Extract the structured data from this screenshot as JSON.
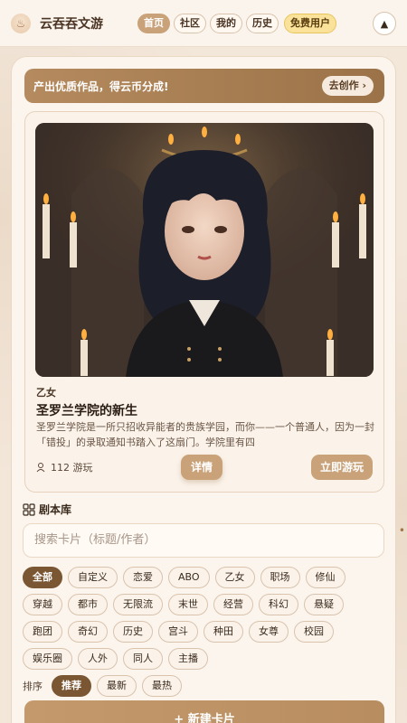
{
  "app": {
    "title": "云吞吞文游",
    "logo_icon": "♨"
  },
  "nav": {
    "tabs": [
      {
        "label": "首页",
        "active": true
      },
      {
        "label": "社区",
        "active": false
      },
      {
        "label": "我的",
        "active": false
      },
      {
        "label": "历史",
        "active": false
      }
    ],
    "badge": "免费用户",
    "up_icon": "▲"
  },
  "promo": {
    "text": "产出优质作品，得云币分成!",
    "button": "去创作 ›"
  },
  "featured": {
    "genre": "乙女",
    "title": "圣罗兰学院的新生",
    "desc": "圣罗兰学院是一所只招收异能者的贵族学园，而你——一个普通人，因为一封「错投」的录取通知书踏入了这扇门。学院里有四",
    "plays": "112 游玩",
    "detail_button": "详情",
    "play_button": "立即游玩"
  },
  "library": {
    "title": "剧本库",
    "search_placeholder": "搜索卡片（标题/作者）",
    "categories": [
      "全部",
      "自定义",
      "恋爱",
      "ABO",
      "乙女",
      "职场",
      "修仙",
      "穿越",
      "都市",
      "无限流",
      "末世",
      "经营",
      "科幻",
      "悬疑",
      "跑团",
      "奇幻",
      "历史",
      "宫斗",
      "种田",
      "女尊",
      "校园",
      "娱乐圈",
      "人外",
      "同人",
      "主播"
    ],
    "sort_label": "排序",
    "sort_options": [
      "推荐",
      "最新",
      "最热"
    ],
    "new_card_button": "+ 新建卡片"
  },
  "colors": {
    "accent": "#c9a27a",
    "dark_accent": "#7a5632",
    "badge": "#fbe29a"
  }
}
